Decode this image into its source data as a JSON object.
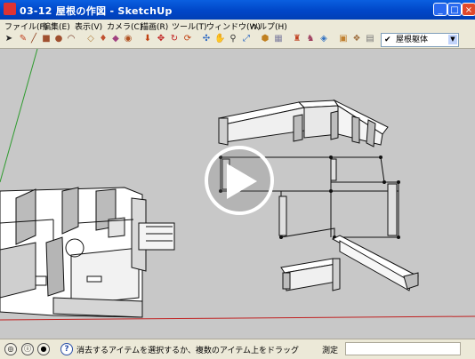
{
  "window": {
    "title": "03-12 屋根の作図 - SketchUp"
  },
  "menu": {
    "items": [
      "ファイル(F)",
      "編集(E)",
      "表示(V)",
      "カメラ(C)",
      "描画(R)",
      "ツール(T)",
      "ウィンドウ(W)",
      "ヘルプ(H)"
    ]
  },
  "toolbar": {
    "layer_select_value": "屋根躯体"
  },
  "status": {
    "message": "消去するアイテムを選択するか、複数のアイテム上をドラッグ",
    "measure_label": "測定",
    "measure_value": ""
  },
  "icons": {
    "app": "sketchup-icon",
    "play": "play-icon"
  }
}
